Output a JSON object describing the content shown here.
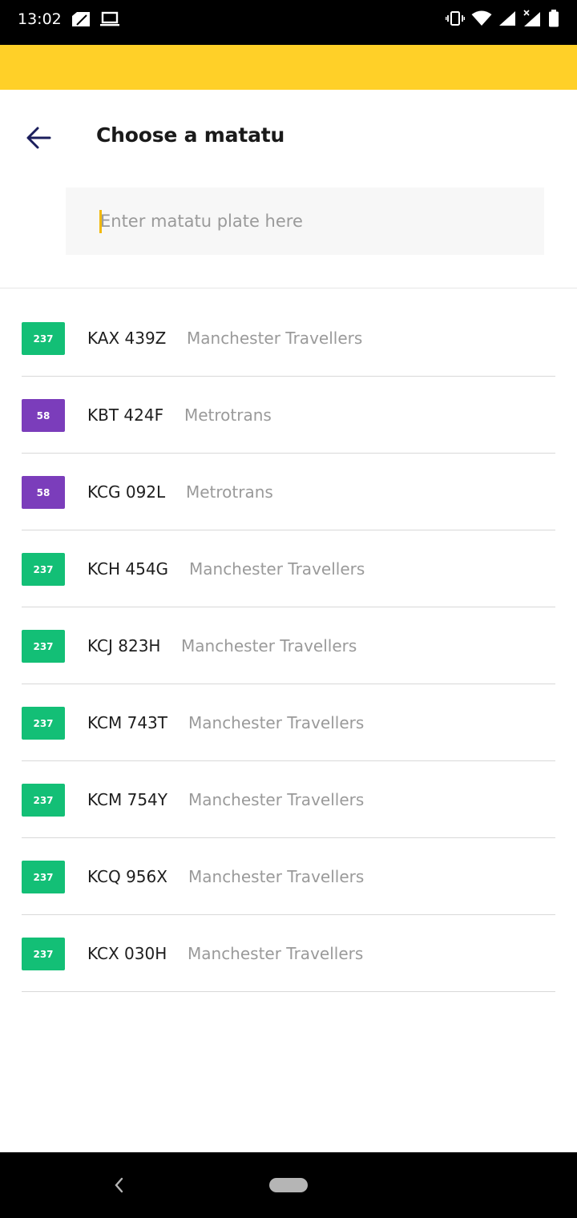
{
  "status_bar": {
    "time": "13:02",
    "left_icons": [
      "sim-card-icon",
      "laptop-icon"
    ],
    "right_icons": [
      "vibrate-icon",
      "wifi-icon",
      "signal-icon",
      "signal-no-data-icon",
      "battery-icon"
    ]
  },
  "header": {
    "title": "Choose a matatu",
    "back_icon": "arrow-left-icon"
  },
  "search": {
    "placeholder": "Enter matatu plate here",
    "value": ""
  },
  "colors": {
    "accent_yellow": "#FFD028",
    "route_237": "#13BF76",
    "route_58": "#7B3DBB",
    "back_arrow": "#1B1E5C"
  },
  "matatus": [
    {
      "route": "237",
      "plate": "KAX 439Z",
      "operator": "Manchester Travellers",
      "color": "#13BF76"
    },
    {
      "route": "58",
      "plate": "KBT 424F",
      "operator": "Metrotrans",
      "color": "#7B3DBB"
    },
    {
      "route": "58",
      "plate": "KCG 092L",
      "operator": "Metrotrans",
      "color": "#7B3DBB"
    },
    {
      "route": "237",
      "plate": "KCH 454G",
      "operator": "Manchester Travellers",
      "color": "#13BF76"
    },
    {
      "route": "237",
      "plate": "KCJ 823H",
      "operator": "Manchester Travellers",
      "color": "#13BF76"
    },
    {
      "route": "237",
      "plate": "KCM 743T",
      "operator": "Manchester Travellers",
      "color": "#13BF76"
    },
    {
      "route": "237",
      "plate": "KCM 754Y",
      "operator": "Manchester Travellers",
      "color": "#13BF76"
    },
    {
      "route": "237",
      "plate": "KCQ 956X",
      "operator": "Manchester Travellers",
      "color": "#13BF76"
    },
    {
      "route": "237",
      "plate": "KCX 030H",
      "operator": "Manchester Travellers",
      "color": "#13BF76"
    }
  ],
  "nav_bar": {
    "icons": [
      "nav-back-icon",
      "home-pill-icon"
    ]
  }
}
